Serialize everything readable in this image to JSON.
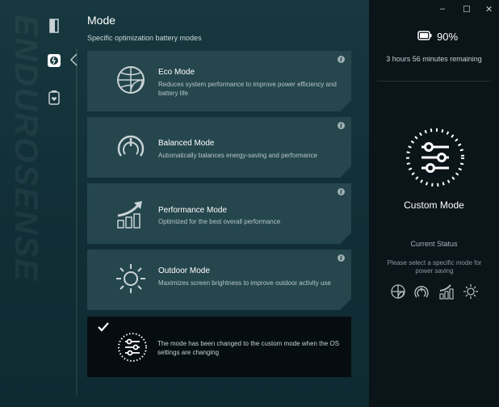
{
  "brand_watermark": "ENDUROSENSE",
  "header": {
    "title": "Mode",
    "subtitle": "Specific optimization battery modes"
  },
  "modes": [
    {
      "id": "eco",
      "name": "Eco Mode",
      "description": "Reduces system performance to improve power efficiency and battery life",
      "icon": "globe-leaf-icon",
      "info": "i"
    },
    {
      "id": "balanced",
      "name": "Balanced Mode",
      "description": "Automatically balances energy-saving and performance",
      "icon": "speedometer-icon",
      "info": "i"
    },
    {
      "id": "performance",
      "name": "Performance Mode",
      "description": "Optimized for the best overall performance",
      "icon": "growth-chart-icon",
      "info": "i"
    },
    {
      "id": "outdoor",
      "name": "Outdoor Mode",
      "description": "Maximizes screen brightness to improve outdoor activity use",
      "icon": "sun-icon",
      "info": "i"
    }
  ],
  "custom_notice": {
    "description": "The mode has been changed to the custom mode when the OS settings are changing",
    "icon": "sliders-icon",
    "selected": true
  },
  "sidebar": {
    "battery_percent": "90%",
    "remaining": "3 hours 56 minutes remaining",
    "current_mode": "Custom Mode",
    "status_title": "Current Status",
    "status_desc": "Please select a specific mode for power saving"
  },
  "window_controls": {
    "minimize": "–",
    "maximize": "☐",
    "close": "✕"
  },
  "colors": {
    "main_bg": "#17383f",
    "card_bg": "#25464d",
    "custom_card_bg": "#060d10",
    "side_bg": "#0a1419"
  }
}
